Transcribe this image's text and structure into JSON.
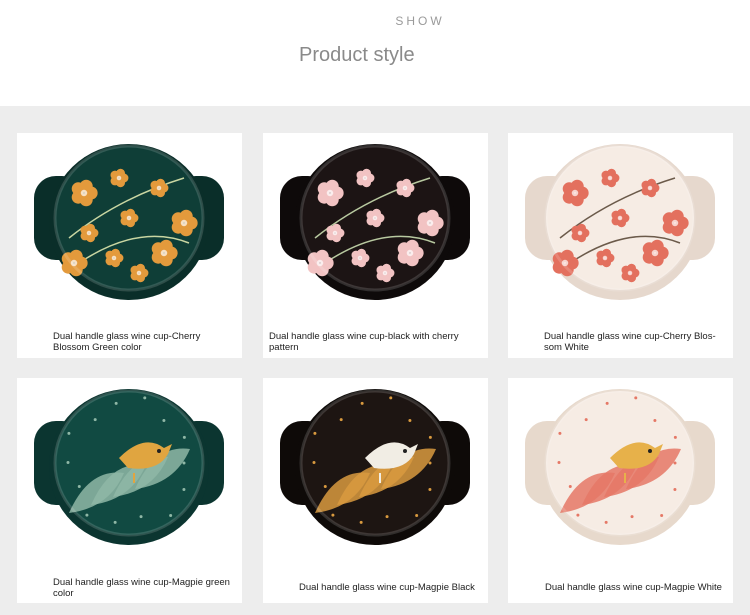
{
  "header": {
    "eyebrow": "SHOW",
    "title": "Product style"
  },
  "products": [
    {
      "name": "Dual handle glass wine cup-Cherry Blossom Green color",
      "style": "cherry",
      "glaze": "#0f3e37",
      "rim": "#0a2e29",
      "flower": "#e39a3c",
      "leaf": "#c9d6a2"
    },
    {
      "name": "Dual handle glass wine cup-black with cherry pattern",
      "style": "cherry",
      "glaze": "#1c1414",
      "rim": "#0e0a0a",
      "flower": "#f2c3c3",
      "leaf": "#b8c9a0"
    },
    {
      "name": "Dual handle glass wine cup-Cherry Blos-som White",
      "style": "cherry",
      "glaze": "#f6ece4",
      "rim": "#e6d8cd",
      "flower": "#e3705e",
      "leaf": "#6b5a4a"
    },
    {
      "name": "Dual handle glass wine cup-Magpie green color",
      "style": "magpie",
      "glaze": "#114a42",
      "rim": "#0b3530",
      "bird": "#e0a540",
      "leafc": "#8fb7a6"
    },
    {
      "name": "Dual handle glass wine cup-Magpie Black",
      "style": "magpie",
      "glaze": "#1d1512",
      "rim": "#0e0a08",
      "bird": "#f1ede4",
      "leafc": "#d99a3f"
    },
    {
      "name": "Dual handle glass wine cup-Magpie White",
      "style": "magpie",
      "glaze": "#f6ece4",
      "rim": "#e7d9cc",
      "bird": "#e7b14a",
      "leafc": "#e57866"
    }
  ]
}
